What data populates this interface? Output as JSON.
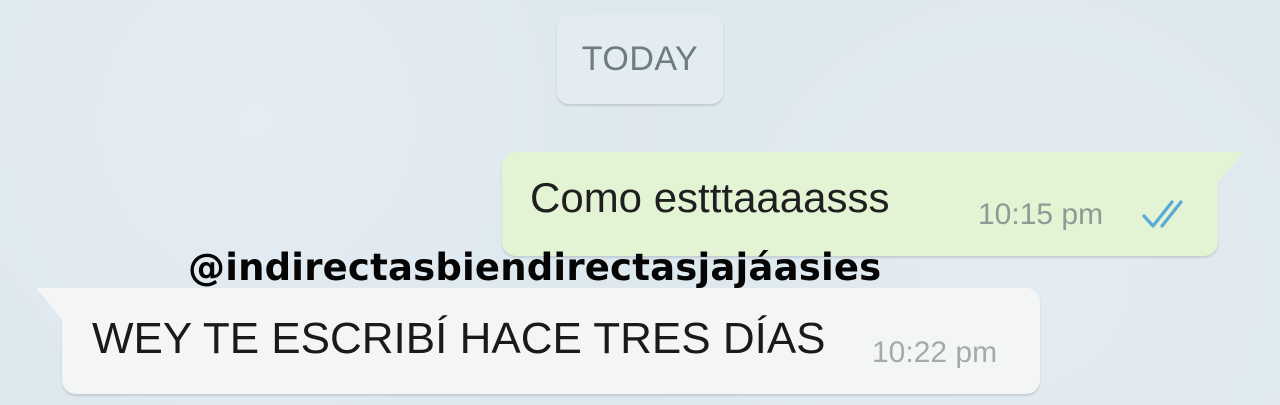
{
  "date_divider": {
    "label": "TODAY"
  },
  "messages": [
    {
      "direction": "outgoing",
      "text": "Como estttaaaasss",
      "time": "10:15 pm",
      "status_icon": "double-check-icon",
      "status": "read",
      "bubble_color": "#e3f4d4",
      "status_color": "#5aa9d8"
    },
    {
      "direction": "incoming",
      "text": "WEY TE ESCRIBÍ HACE TRES DÍAS",
      "time": "10:22 pm",
      "bubble_color": "#f4f6f6"
    }
  ],
  "watermark": {
    "text": "@indirectasbiendirectasjajáasies"
  },
  "colors": {
    "background": "#dce7ee",
    "date_chip": "#e3ecf1",
    "watermark_text": "#050505"
  }
}
